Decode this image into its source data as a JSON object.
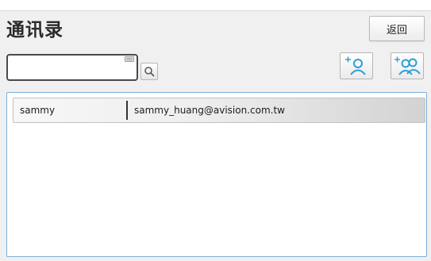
{
  "header": {
    "title": "通讯录",
    "back_label": "返回"
  },
  "search": {
    "value": "",
    "placeholder": ""
  },
  "icons": {
    "search": "magnifier-icon",
    "keyboard": "keyboard-icon",
    "add_contact": "add-contact-icon",
    "add_group": "add-group-icon"
  },
  "colors": {
    "accent": "#2a9fd6",
    "panel_border": "#7aaedc"
  },
  "contacts": [
    {
      "name": "sammy",
      "email": "sammy_huang@avision.com.tw"
    }
  ]
}
